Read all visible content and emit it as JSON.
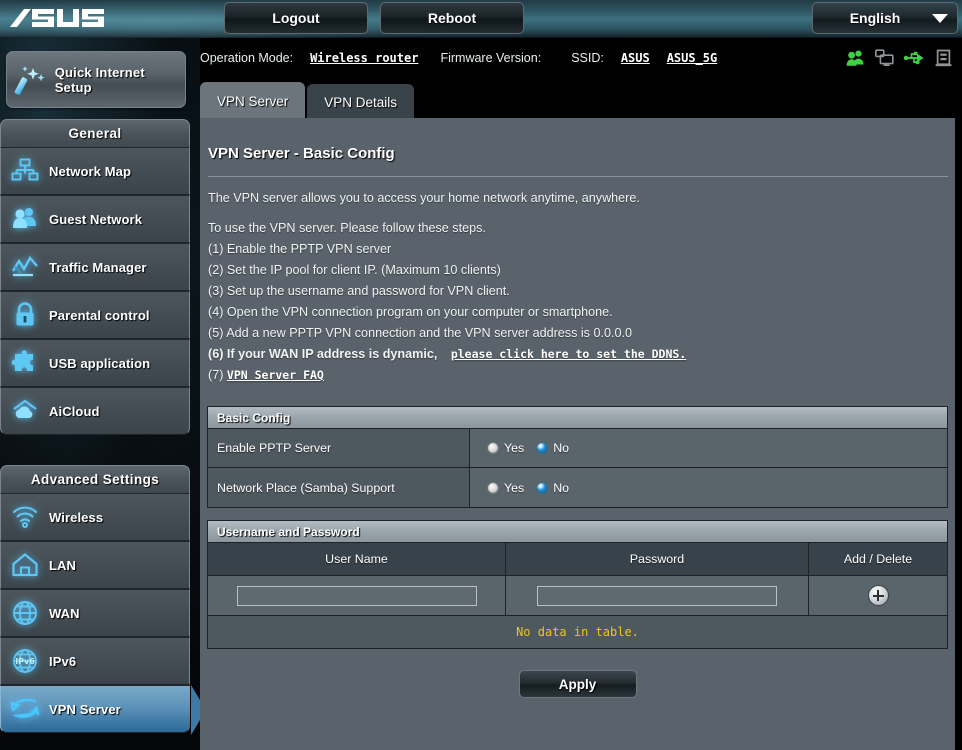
{
  "header": {
    "logo_alt": "ASUS",
    "logout_label": "Logout",
    "reboot_label": "Reboot",
    "language": "English",
    "caret_icon": "chevron-down-icon"
  },
  "infobar": {
    "operation_mode_label": "Operation Mode:",
    "operation_mode_value": "Wireless router",
    "firmware_label": "Firmware Version:",
    "firmware_value": "",
    "ssid_label": "SSID:",
    "ssid_1": "ASUS",
    "ssid_2": "ASUS_5G",
    "icons": [
      {
        "name": "clients-icon",
        "color": "#3fd13f"
      },
      {
        "name": "network-devices-icon",
        "color": "#8e9699"
      },
      {
        "name": "usb-icon",
        "color": "#3fd13f"
      },
      {
        "name": "printer-icon",
        "color": "#8e9699"
      }
    ]
  },
  "sidebar": {
    "quick_setup": {
      "label": "Quick Internet Setup",
      "icon": "magic-wand-icon"
    },
    "groups": [
      {
        "title": "General",
        "items": [
          {
            "label": "Network Map",
            "icon": "network-map-icon",
            "active": false
          },
          {
            "label": "Guest Network",
            "icon": "guest-network-icon",
            "active": false
          },
          {
            "label": "Traffic Manager",
            "icon": "traffic-manager-icon",
            "active": false
          },
          {
            "label": "Parental control",
            "icon": "lock-icon",
            "active": false
          },
          {
            "label": "USB application",
            "icon": "puzzle-icon",
            "active": false
          },
          {
            "label": "AiCloud",
            "icon": "cloud-icon",
            "active": false
          }
        ]
      },
      {
        "title": "Advanced Settings",
        "items": [
          {
            "label": "Wireless",
            "icon": "wifi-icon",
            "active": false
          },
          {
            "label": "LAN",
            "icon": "home-icon",
            "active": false
          },
          {
            "label": "WAN",
            "icon": "globe-icon",
            "active": false
          },
          {
            "label": "IPv6",
            "icon": "ipv6-globe-icon",
            "active": false
          },
          {
            "label": "VPN Server",
            "icon": "vpn-arrows-icon",
            "active": true
          }
        ]
      }
    ]
  },
  "tabs": [
    {
      "label": "VPN Server",
      "active": true
    },
    {
      "label": "VPN Details",
      "active": false
    }
  ],
  "main": {
    "title": "VPN Server - Basic Config",
    "intro": "The VPN server allows you to access your home network anytime, anywhere.",
    "steps_intro": "To use the VPN server. Please follow these steps.",
    "steps": [
      "(1) Enable the PPTP VPN server",
      "(2) Set the IP pool for client IP. (Maximum 10 clients)",
      "(3) Set up the username and password for VPN client.",
      "(4) Open the VPN connection program on your computer or smartphone.",
      "(5) Add a new PPTP VPN connection and the VPN server address is 0.0.0.0"
    ],
    "step6_prefix": "(6) If your WAN IP address is dynamic,",
    "step6_link": "please click here to set the DDNS.",
    "step7_prefix": "(7)",
    "step7_link": "VPN Server FAQ"
  },
  "basic_config": {
    "section_title": "Basic Config",
    "rows": [
      {
        "label": "Enable PPTP Server",
        "options": [
          {
            "label": "Yes",
            "checked": false
          },
          {
            "label": "No",
            "checked": true
          }
        ]
      },
      {
        "label": "Network Place (Samba) Support",
        "options": [
          {
            "label": "Yes",
            "checked": false
          },
          {
            "label": "No",
            "checked": true
          }
        ]
      }
    ]
  },
  "user_table": {
    "section_title": "Username and Password",
    "columns": [
      "User Name",
      "Password",
      "Add / Delete"
    ],
    "input_row": {
      "username_value": "",
      "username_placeholder": "",
      "password_value": "",
      "password_placeholder": "",
      "add_icon": "plus-circle-icon"
    },
    "empty_message": "No data in table."
  },
  "footer": {
    "apply_label": "Apply"
  },
  "colors": {
    "panel_bg": "#5a636b",
    "accent_blue": "#2b6a99",
    "warning_yellow": "#f0c419",
    "icon_green": "#3fd13f"
  }
}
